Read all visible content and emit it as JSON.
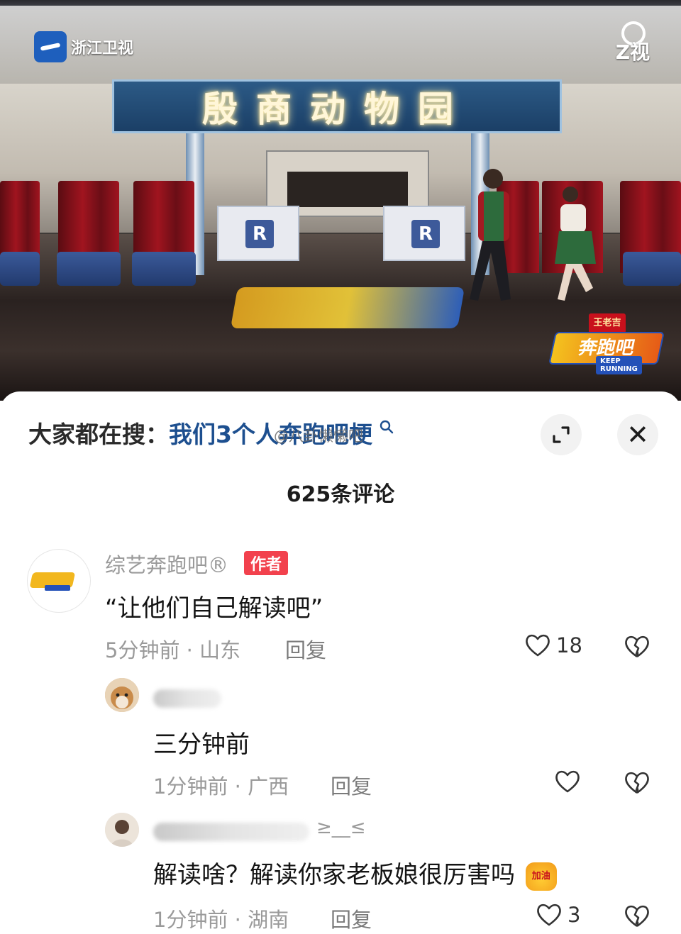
{
  "video": {
    "channel_name": "浙江卫视",
    "corner_logo": "Z视",
    "sign_text": "殷商动物园",
    "desk_mark": "R",
    "show_logo": {
      "badge": "王老吉",
      "title": "奔跑吧",
      "subtitle_line1": "KEEP",
      "subtitle_line2": "RUNNING"
    }
  },
  "search": {
    "prefix": "大家都在搜：",
    "query": "我们3个人奔跑吧梗",
    "search_icon": "search-icon"
  },
  "watermark": "@八卦懒懒吧",
  "sheet_buttons": {
    "expand_icon": "expand-icon",
    "close_glyph": "✕"
  },
  "comment_count": "625条评论",
  "comments": [
    {
      "user": "综艺奔跑吧®",
      "tag": "作者",
      "text": "“让他们自己解读吧”",
      "time": "5分钟前",
      "location": "山东",
      "reply": "回复",
      "likes": "18"
    },
    {
      "user": "",
      "text": "三分钟前",
      "time": "1分钟前",
      "location": "广西",
      "reply": "回复",
      "likes": ""
    },
    {
      "user": "",
      "user_suffix": "≥__≤",
      "text": "解读啥？解读你家老板娘很厉害吗",
      "emoji": "加油",
      "time": "1分钟前",
      "location": "湖南",
      "reply": "回复",
      "likes": "3"
    }
  ],
  "colors": {
    "link_blue": "#1d4f8f",
    "tag_red": "#f2414d",
    "meta_gray": "#9a9a9a"
  }
}
